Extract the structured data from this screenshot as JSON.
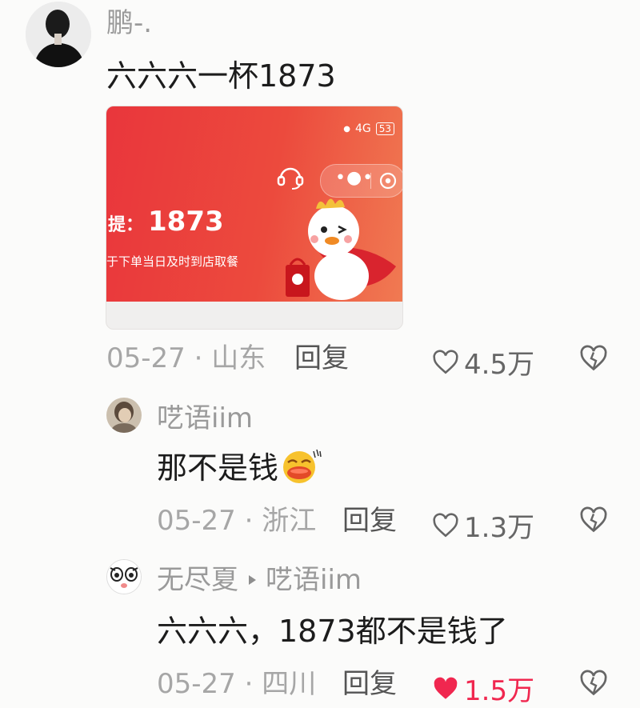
{
  "comments": [
    {
      "username": "鹏-.",
      "text": "六六六一杯1873",
      "date": "05-27",
      "location": "山东",
      "reply_label": "回复",
      "likes": "4.5万",
      "liked": false,
      "attachment": {
        "status_network": "4G",
        "status_battery": "53",
        "pickup_label": "提：",
        "pickup_code": "1873",
        "pickup_note": "于下单当日及时到店取餐"
      }
    },
    {
      "username": "呓语iim",
      "text": "那不是钱",
      "date": "05-27",
      "location": "浙江",
      "reply_label": "回复",
      "likes": "1.3万",
      "liked": false
    },
    {
      "username": "无尽夏",
      "reply_to": "呓语iim",
      "text": "六六六，1873都不是钱了",
      "date": "05-27",
      "location": "四川",
      "reply_label": "回复",
      "likes": "1.5万",
      "liked": true
    }
  ],
  "colors": {
    "like_active": "#f0274f",
    "card_red": "#e9363c"
  },
  "icons": [
    "heart-icon",
    "dislike-heart-icon",
    "emoji-laughing-icon",
    "reply-arrow-icon"
  ]
}
